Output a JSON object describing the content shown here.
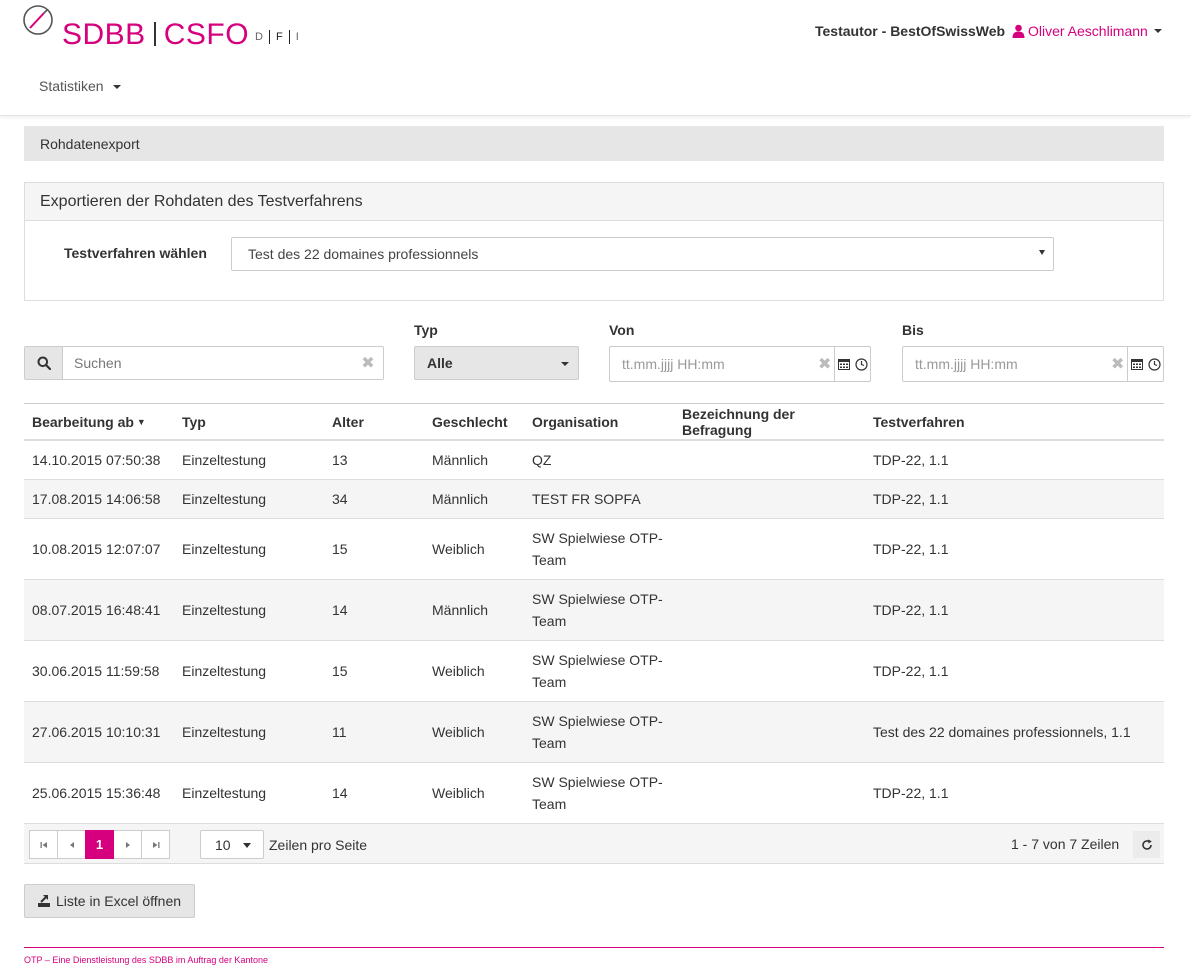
{
  "header": {
    "brand_left": "SDBB",
    "brand_right": "CSFO",
    "languages": [
      "D",
      "F",
      "I"
    ],
    "active_language": "F",
    "org_name": "Testautor - BestOfSwissWeb",
    "user_name": "Oliver Aeschlimann",
    "nav_statistics": "Statistiken",
    "brand_color": "#d6007e"
  },
  "breadcrumb": "Rohdatenexport",
  "panel": {
    "title": "Exportieren der Rohdaten des Testverfahrens",
    "select_label": "Testverfahren wählen",
    "select_value": "Test des 22 domaines professionnels"
  },
  "filters": {
    "search_placeholder": "Suchen",
    "typ_label": "Typ",
    "typ_value": "Alle",
    "von_label": "Von",
    "bis_label": "Bis",
    "date_placeholder": "tt.mm.jjjj HH:mm"
  },
  "table": {
    "columns": [
      "Bearbeitung ab",
      "Typ",
      "Alter",
      "Geschlecht",
      "Organisation",
      "Bezeichnung der Befragung",
      "Testverfahren"
    ],
    "sort_indicator": "▼",
    "rows": [
      {
        "date": "14.10.2015 07:50:38",
        "typ": "Einzeltestung",
        "alter": "13",
        "geschlecht": "Männlich",
        "org": "QZ",
        "bez": "",
        "test": "TDP-22, 1.1"
      },
      {
        "date": "17.08.2015 14:06:58",
        "typ": "Einzeltestung",
        "alter": "34",
        "geschlecht": "Männlich",
        "org": "TEST FR SOPFA",
        "bez": "",
        "test": "TDP-22, 1.1"
      },
      {
        "date": "10.08.2015 12:07:07",
        "typ": "Einzeltestung",
        "alter": "15",
        "geschlecht": "Weiblich",
        "org": "SW Spielwiese OTP-Team",
        "bez": "",
        "test": "TDP-22, 1.1"
      },
      {
        "date": "08.07.2015 16:48:41",
        "typ": "Einzeltestung",
        "alter": "14",
        "geschlecht": "Männlich",
        "org": "SW Spielwiese OTP-Team",
        "bez": "",
        "test": "TDP-22, 1.1"
      },
      {
        "date": "30.06.2015 11:59:58",
        "typ": "Einzeltestung",
        "alter": "15",
        "geschlecht": "Weiblich",
        "org": "SW Spielwiese OTP-Team",
        "bez": "",
        "test": "TDP-22, 1.1"
      },
      {
        "date": "27.06.2015 10:10:31",
        "typ": "Einzeltestung",
        "alter": "11",
        "geschlecht": "Weiblich",
        "org": "SW Spielwiese OTP-Team",
        "bez": "",
        "test": "Test des 22 domaines professionnels, 1.1"
      },
      {
        "date": "25.06.2015 15:36:48",
        "typ": "Einzeltestung",
        "alter": "14",
        "geschlecht": "Weiblich",
        "org": "SW Spielwiese OTP-Team",
        "bez": "",
        "test": "TDP-22, 1.1"
      }
    ]
  },
  "pager": {
    "current_page": "1",
    "page_size": "10",
    "page_size_label": "Zeilen pro Seite",
    "info": "1 - 7 von 7 Zeilen"
  },
  "excel_button": "Liste in Excel öffnen",
  "footer": "OTP – Eine Dienstleistung des SDBB im Auftrag der Kantone"
}
